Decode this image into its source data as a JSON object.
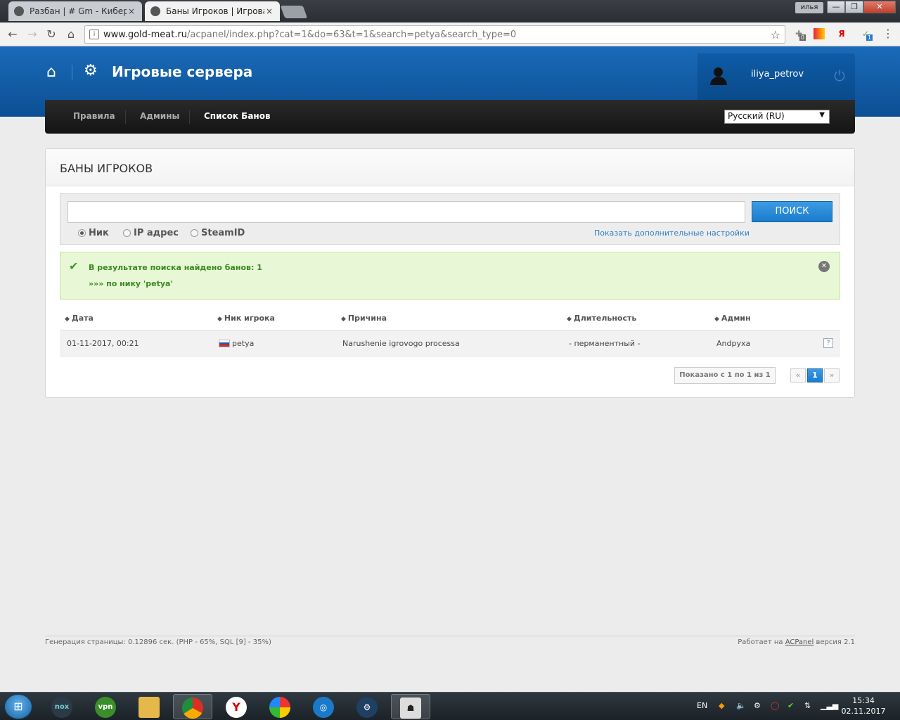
{
  "browser": {
    "tabs": [
      {
        "label": "Разбан | # Gm - Киберс",
        "close": "×"
      },
      {
        "label": "Баны Игроков | Игрова",
        "close": "×"
      }
    ],
    "user_badge": "илья",
    "window_buttons": {
      "minimize": "—",
      "maximize": "❐",
      "close": "✕"
    },
    "url_host": "www.gold-meat.ru",
    "url_path": "/acpanel/index.php?cat=1&do=63&t=1&search=petya&search_type=0",
    "extensions": [
      {
        "icon": "puzzle-icon",
        "badge": "0"
      },
      {
        "icon": "flag-icon",
        "badge": ""
      },
      {
        "icon": "yandex-icon",
        "badge": ""
      },
      {
        "icon": "antivirus-icon",
        "badge": "1"
      }
    ]
  },
  "site": {
    "title": "Игровые сервера",
    "username": "iliya_petrov"
  },
  "nav": {
    "items": [
      "Правила",
      "Админы",
      "Список Банов"
    ],
    "active": "Список Банов",
    "language": "Русский (RU)"
  },
  "bans": {
    "heading": "БАНЫ ИГРОКОВ",
    "search": {
      "value": "",
      "button": "ПОИСК",
      "options": [
        "Ник",
        "IP адрес",
        "SteamID"
      ],
      "selected": "Ник",
      "more_link": "Показать дополнительные настройки"
    },
    "alert": {
      "line1": "В результате поиска найдено банов: 1",
      "line2": "»»» по нику 'petya'"
    },
    "columns": [
      "Дата",
      "Ник игрока",
      "Причина",
      "Длительность",
      "Админ"
    ],
    "rows": [
      {
        "date": "01-11-2017, 00:21",
        "nick": "petya",
        "reason": "Narushenie igrovogo processa",
        "duration": "- перманентный -",
        "admin": "Andpyxa",
        "country_flag": "ru"
      }
    ],
    "pagination": {
      "info": "Показано с 1 по 1 из 1",
      "prev": "«",
      "pages": [
        "1"
      ],
      "current": "1",
      "next": "»"
    }
  },
  "footer": {
    "left": "Генерация страницы: 0.12896 сек. (PHP - 65%, SQL [9] - 35%)",
    "right_prefix": "Работает на",
    "right_link": "ACPanel",
    "right_suffix": "версия 2.1"
  },
  "taskbar": {
    "apps": [
      "nox",
      "vpn",
      "explorer",
      "chrome",
      "yandex",
      "bluestacks",
      "teamviewer",
      "steam",
      "counter-strike"
    ],
    "lang": "EN",
    "time": "15:34",
    "date": "02.11.2017"
  }
}
